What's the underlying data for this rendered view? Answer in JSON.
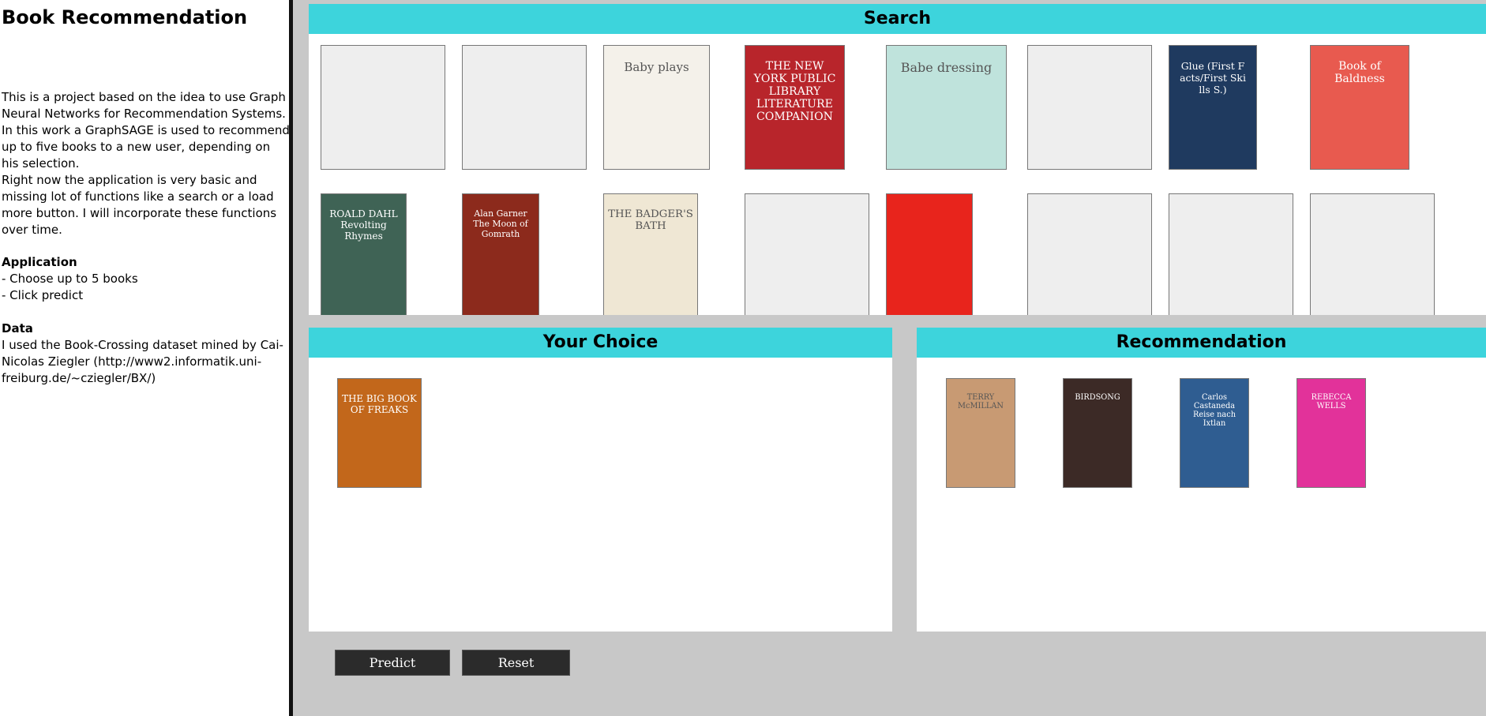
{
  "sidebar": {
    "title": "Book Recommendation",
    "intro_1": "This is a project based on the idea to use Graph Neural Networks for Recommendation Systems. In this work a GraphSAGE is used to recommend up to five books to a new user, depending on his selection.",
    "intro_2": "Right now the application is very basic and missing lot of functions like a search or a load more button. I will incorporate these functions over time.",
    "application_heading": "Application",
    "application_items": [
      "- Choose up to 5 books",
      "- Click predict"
    ],
    "data_heading": "Data",
    "data_text": "I used the Book-Crossing dataset mined by Cai-Nicolas Ziegler (http://www2.informatik.uni-freiburg.de/~cziegler/BX/)"
  },
  "search": {
    "title": "Search",
    "covers": [
      {
        "text": "",
        "bg": "#eeeeee"
      },
      {
        "text": "",
        "bg": "#eeeeee"
      },
      {
        "text": "Baby plays",
        "bg": "#f4f1ea"
      },
      {
        "text": "THE NEW YORK PUBLIC LIBRARY LITERATURE COMPANION",
        "bg": "#b8252b"
      },
      {
        "text": "Babe dressing",
        "bg": "#bfe3dc"
      },
      {
        "text": "",
        "bg": "#eeeeee"
      },
      {
        "text": "Glue (First F acts/First Ski lls S.)",
        "bg": "#1f3a5f"
      },
      {
        "text": "Book of Baldness",
        "bg": "#e85a4f"
      },
      {
        "text": "ROALD DAHL Revolting Rhymes",
        "bg": "#3f6355"
      },
      {
        "text": "Alan Garner The Moon of Gomrath",
        "bg": "#8c2a1c"
      },
      {
        "text": "THE BADGER'S BATH",
        "bg": "#efe7d4"
      },
      {
        "text": "",
        "bg": "#eeeeee"
      },
      {
        "text": "",
        "bg": "#e8241c"
      },
      {
        "text": "",
        "bg": "#eeeeee"
      },
      {
        "text": "",
        "bg": "#eeeeee"
      },
      {
        "text": "",
        "bg": "#eeeeee"
      }
    ]
  },
  "choice": {
    "title": "Your Choice",
    "covers": [
      {
        "text": "THE BIG BOOK OF FREAKS",
        "bg": "#c2671b"
      }
    ]
  },
  "recommendation": {
    "title": "Recommendation",
    "covers": [
      {
        "text": "TERRY McMILLAN",
        "bg": "#c89a73"
      },
      {
        "text": "BIRDSONG",
        "bg": "#3c2a26"
      },
      {
        "text": "Carlos Castaneda Reise nach Ixtlan",
        "bg": "#2f5d91"
      },
      {
        "text": "REBECCA WELLS",
        "bg": "#e2329a"
      }
    ]
  },
  "buttons": {
    "predict": "Predict",
    "reset": "Reset"
  }
}
